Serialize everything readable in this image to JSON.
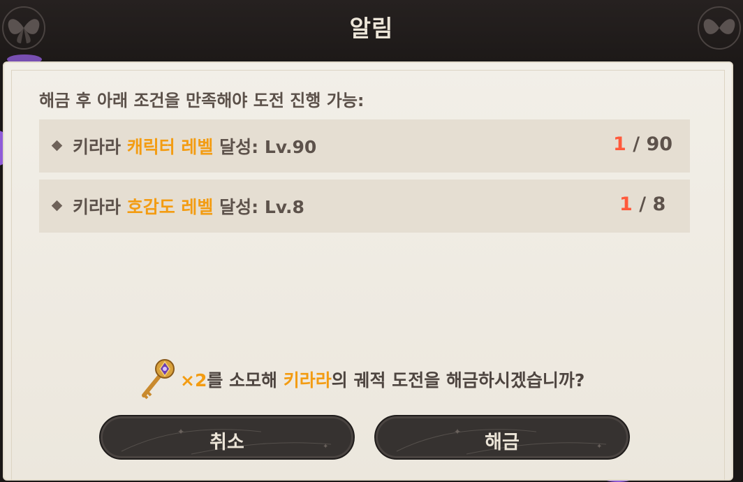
{
  "header": {
    "title": "알림"
  },
  "dialog": {
    "intro": "해금 후 아래 조건을 만족해야 도전 진행 가능:",
    "conditions": [
      {
        "prefix": "키라라 ",
        "highlight": "캐릭터 레벨",
        "suffix": " 달성: Lv.90",
        "current": "1",
        "total": " / 90"
      },
      {
        "prefix": "키라라 ",
        "highlight": "호감도 레벨",
        "suffix": " 달성: Lv.8",
        "current": "1",
        "total": " / 8"
      }
    ],
    "confirm": {
      "item_icon": "golden-key-icon",
      "count": "×2",
      "part1": "를 소모해 ",
      "character": "키라라",
      "part2": "의 궤적 도전을 해금하시겠습니까?"
    },
    "buttons": {
      "cancel": "취소",
      "unlock": "해금"
    }
  },
  "colors": {
    "highlight": "#f39c12",
    "current_progress": "#ff5a3c",
    "button_bg": "#363230",
    "panel_bg": "#f2efe8"
  }
}
